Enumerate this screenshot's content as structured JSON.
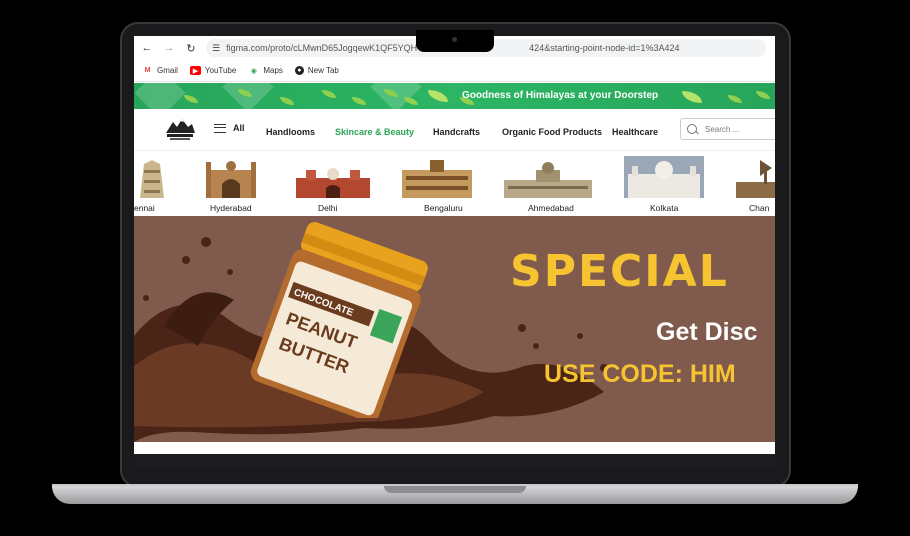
{
  "browser": {
    "url_left": "figma.com/proto/cLMwnD65Jogqew",
    "url_mid": "K1QF5YQH",
    "url_right": "424&starting-point-node-id=1%3A424",
    "bookmarks": [
      {
        "label": "Gmail",
        "icon": "gmail-icon",
        "color": "#ea4335"
      },
      {
        "label": "YouTube",
        "icon": "youtube-icon",
        "color": "#ff0000"
      },
      {
        "label": "Maps",
        "icon": "maps-icon",
        "color": "#34a853"
      },
      {
        "label": "New Tab",
        "icon": "globe-icon",
        "color": "#202124"
      }
    ]
  },
  "promo": {
    "text": "Goodness of Himalayas at your Doorstep"
  },
  "header": {
    "menu_all": "All",
    "nav": [
      {
        "label": "Handlooms",
        "active": false
      },
      {
        "label": "Skincare & Beauty",
        "active": true
      },
      {
        "label": "Handcrafts",
        "active": false
      },
      {
        "label": "Organic Food Products",
        "active": false
      },
      {
        "label": "Healthcare",
        "active": false
      }
    ],
    "search_placeholder": "Search ..."
  },
  "cities": [
    "ennai",
    "Hyderabad",
    "Delhi",
    "Bengaluru",
    "Ahmedabad",
    "Kolkata",
    "Chan"
  ],
  "banner": {
    "headline": "SPECIAL",
    "subhead": "Get Disc",
    "code": "USE CODE: HIM",
    "jar_top": "CHOCOLATE",
    "jar_mid": "PEANUT",
    "jar_bottom": "BUTTER"
  },
  "colors": {
    "brand_green": "#2aa658",
    "banner_brown": "#805a4c",
    "accent_yellow": "#f6c431"
  }
}
